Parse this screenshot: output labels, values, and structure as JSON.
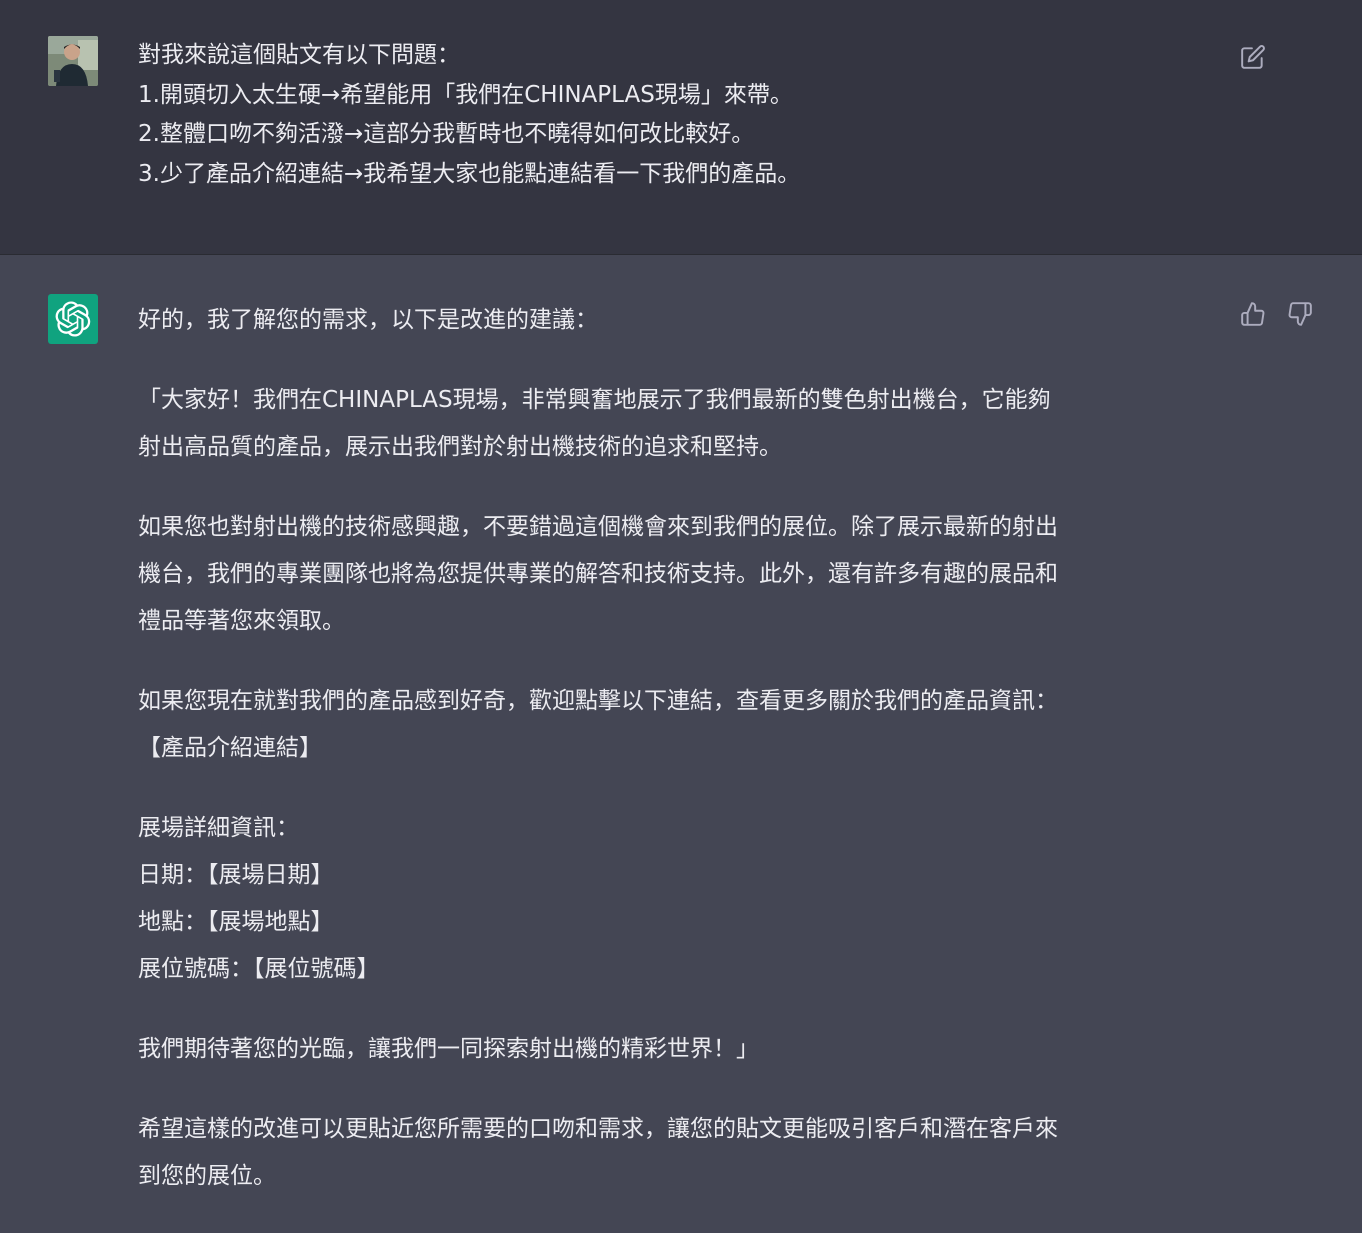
{
  "user_message": {
    "lines": [
      "對我來說這個貼文有以下問題：",
      "1.開頭切入太生硬→希望能用「我們在CHINAPLAS現場」來帶。",
      "2.整體口吻不夠活潑→這部分我暫時也不曉得如何改比較好。",
      "3.少了產品介紹連結→我希望大家也能點連結看一下我們的產品。"
    ],
    "edit_icon": "edit-icon"
  },
  "assistant_message": {
    "intro": "好的，我了解您的需求，以下是改進的建議：",
    "para1": [
      "「大家好！我們在CHINAPLAS現場，非常興奮地展示了我們最新的雙色射出機台，它能夠",
      "射出高品質的產品，展示出我們對於射出機技術的追求和堅持。"
    ],
    "para2": [
      "如果您也對射出機的技術感興趣，不要錯過這個機會來到我們的展位。除了展示最新的射出",
      "機台，我們的專業團隊也將為您提供專業的解答和技術支持。此外，還有許多有趣的展品和",
      "禮品等著您來領取。"
    ],
    "para3": [
      "如果您現在就對我們的產品感到好奇，歡迎點擊以下連結，查看更多關於我們的產品資訊：",
      "【產品介紹連結】"
    ],
    "para4": [
      "展場詳細資訊：",
      "日期：【展場日期】",
      "地點：【展場地點】",
      "展位號碼：【展位號碼】"
    ],
    "para5": [
      "我們期待著您的光臨，讓我們一同探索射出機的精彩世界！」"
    ],
    "para6": [
      "希望這樣的改進可以更貼近您所需要的口吻和需求，讓您的貼文更能吸引客戶和潛在客戶來",
      "到您的展位。"
    ],
    "icons": {
      "avatar": "openai-logo-icon",
      "thumbs_up": "thumbs-up-icon",
      "thumbs_down": "thumbs-down-icon"
    }
  },
  "colors": {
    "user_bg": "#343541",
    "assistant_bg": "#444654",
    "text": "#ececf1",
    "accent": "#10a37f",
    "icon": "#acacbe"
  }
}
